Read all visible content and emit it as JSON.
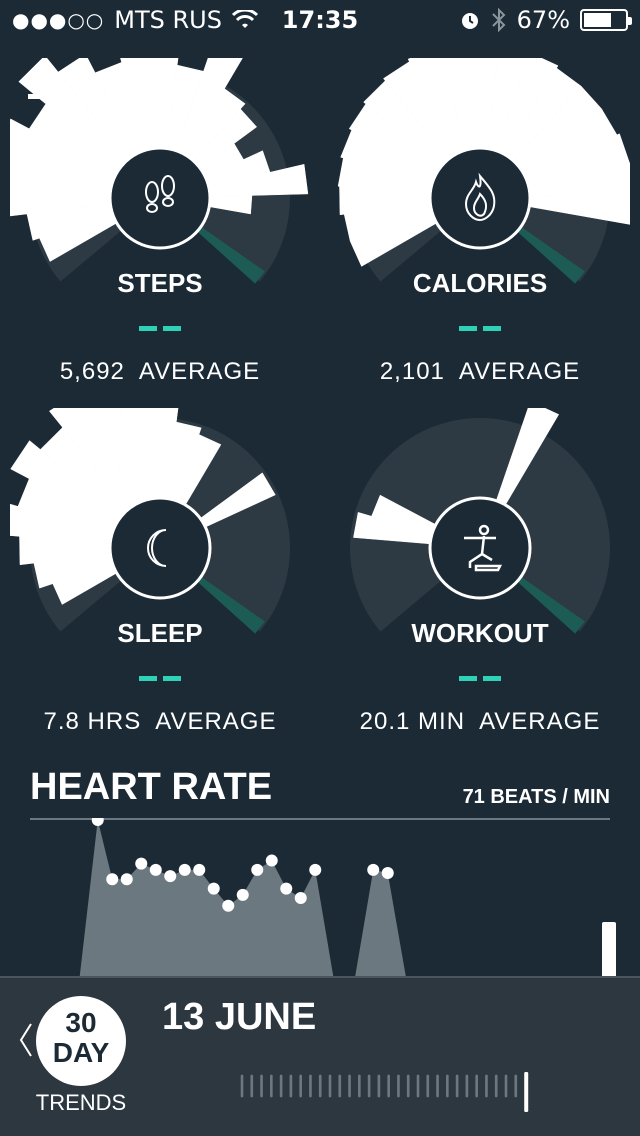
{
  "status_bar": {
    "carrier": "MTS RUS",
    "time": "17:35",
    "battery_percent": "67%",
    "battery_level": 0.67,
    "icons": [
      "signal-dots-icon",
      "wifi-icon",
      "alarm-icon",
      "bluetooth-icon",
      "battery-icon"
    ]
  },
  "menu": {
    "icon": "hamburger-menu-icon"
  },
  "metrics": [
    {
      "label": "STEPS",
      "average": "5,692",
      "average_suffix": "AVERAGE",
      "icon": "footprints-icon",
      "bar_values": [
        0.55,
        0.6,
        0.75,
        0.9,
        0.85,
        0.7,
        0.95,
        0.8,
        0.65,
        0.9,
        0.75,
        0.6,
        0.85,
        0.55,
        0.5,
        0.3,
        0.45,
        0.7,
        0.3
      ]
    },
    {
      "label": "CALORIES",
      "average": "2,101",
      "average_suffix": "AVERAGE",
      "icon": "flame-icon",
      "bar_values": [
        0.62,
        0.62,
        0.65,
        0.66,
        0.68,
        0.7,
        0.72,
        0.74,
        0.76,
        0.78,
        0.78,
        0.76,
        0.74,
        0.72,
        0.72,
        0.72,
        0.74,
        0.76,
        0.76
      ]
    },
    {
      "label": "SLEEP",
      "average": "7.8 HRS",
      "average_suffix": "AVERAGE",
      "icon": "moon-icon",
      "bar_values": [
        0.45,
        0.55,
        0.65,
        0.8,
        0.7,
        0.85,
        0.75,
        0.9,
        0.85,
        0.8,
        0.7,
        0.55,
        0.5,
        0.0,
        0.0,
        0.55,
        0.0,
        0.0,
        0.0
      ]
    },
    {
      "label": "WORKOUT",
      "average": "20.1 MIN",
      "average_suffix": "AVERAGE",
      "icon": "workout-icon",
      "bar_values": [
        0.0,
        0.0,
        0.0,
        0.55,
        0.45,
        0.0,
        0.0,
        0.0,
        0.0,
        0.0,
        0.0,
        0.0,
        0.75,
        0.0,
        0.0,
        0.0,
        0.0,
        0.0,
        0.0
      ]
    }
  ],
  "heart_rate": {
    "title": "HEART RATE",
    "value": "71 BEATS / MIN",
    "points": [
      null,
      null,
      null,
      null,
      null,
      100,
      62,
      62,
      72,
      68,
      64,
      68,
      68,
      56,
      45,
      52,
      68,
      74,
      56,
      50,
      68,
      null,
      null,
      null,
      68,
      66,
      null,
      null,
      null,
      null,
      null,
      null,
      null,
      null,
      null,
      null,
      null,
      null,
      null,
      null
    ]
  },
  "bottom": {
    "back_icon": "chevron-left-icon",
    "trend_number": "30",
    "trend_unit": "DAY",
    "trend_label": "TRENDS",
    "date": "13 JUNE",
    "tick_count": 30,
    "selected_tick": 29
  },
  "colors": {
    "background": "#1c2a35",
    "dial": "#2d3a43",
    "accent": "#2ed3b7",
    "indicator": "#1c5c55",
    "chart_fill": "#6b787f"
  }
}
